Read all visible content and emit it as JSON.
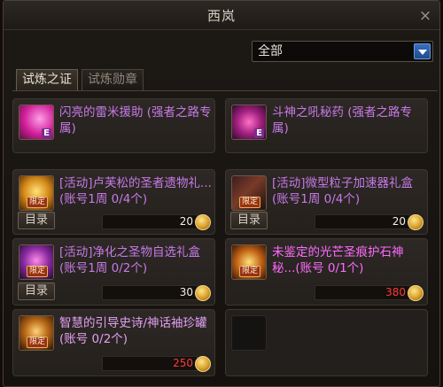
{
  "window": {
    "title": "西岚"
  },
  "filter": {
    "value": "全部"
  },
  "tabs": [
    {
      "label": "试炼之证",
      "active": true
    },
    {
      "label": "试炼勋章",
      "active": false
    }
  ],
  "cards": [
    {
      "icon": "pink-gem-icon",
      "name": "闪亮的雷米援助 (强者之路专属)",
      "tag": "",
      "list_label": "",
      "price": ""
    },
    {
      "icon": "potion-icon",
      "name": "斗神之吼秘药 (强者之路专属)",
      "tag": "",
      "list_label": "",
      "price": ""
    },
    {
      "icon": "gold-chest-icon",
      "name": "[活动]卢芙松的圣者遗物礼...(账号1周 0/4个)",
      "tag": "限定",
      "list_label": "目录",
      "price": "20"
    },
    {
      "icon": "box-icon",
      "name": "[活动]微型粒子加速器礼盒 (账号1周 0/4个)",
      "tag": "限定",
      "list_label": "目录",
      "price": "20"
    },
    {
      "icon": "purple-gift-icon",
      "name": "[活动]净化之圣物自选礼盒 (账号1周 0/2个)",
      "tag": "限定",
      "list_label": "目录",
      "price": "30"
    },
    {
      "icon": "sun-emblem-icon",
      "name": "未鉴定的光芒圣痕护石神秘...(账号 0/1个)",
      "tag": "限定",
      "list_label": "",
      "price": "380"
    },
    {
      "icon": "golden-orb-icon",
      "name": "智慧的引导史诗/神话袖珍罐 (账号 0/2个)",
      "tag": "限定",
      "list_label": "",
      "price": "250"
    }
  ],
  "colors": {
    "price_red": "#ff3a3a",
    "name_purple": "#c67ae6"
  }
}
